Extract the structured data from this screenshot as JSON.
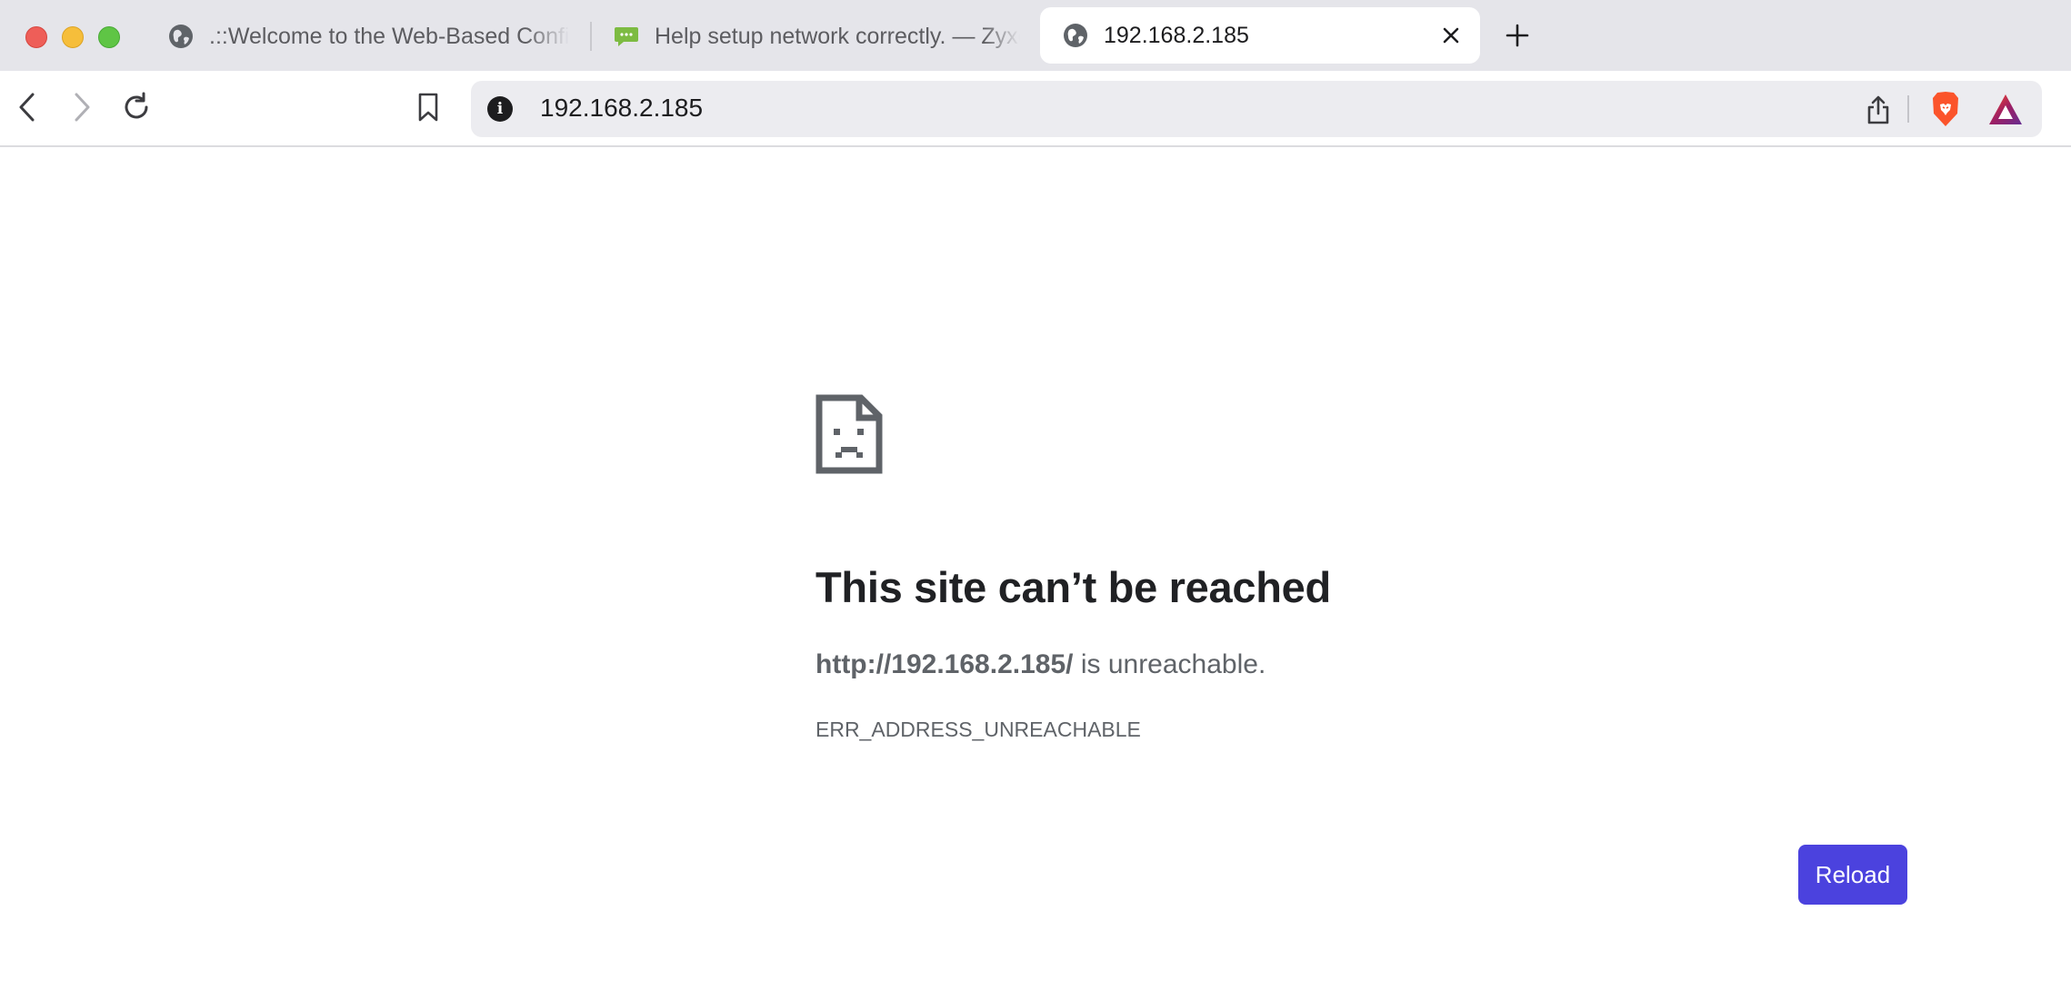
{
  "window": {
    "controls": [
      "close",
      "minimize",
      "zoom"
    ]
  },
  "tabs": [
    {
      "title": ".::Welcome to the Web-Based Configurator::.",
      "icon": "globe-icon",
      "active": false
    },
    {
      "title": "Help setup network correctly. — Zyxel Community",
      "icon": "chat-bubble-icon",
      "active": false
    },
    {
      "title": "192.168.2.185",
      "icon": "globe-icon",
      "active": true
    }
  ],
  "toolbar": {
    "url": "192.168.2.185",
    "site_info_glyph": "i"
  },
  "error_page": {
    "heading": "This site can’t be reached",
    "url_bold": "http://192.168.2.185/",
    "detail_suffix": " is unreachable.",
    "error_code": "ERR_ADDRESS_UNREACHABLE",
    "reload_label": "Reload"
  },
  "colors": {
    "accent_button": "#4b42de",
    "brave_orange": "#fb542b"
  }
}
